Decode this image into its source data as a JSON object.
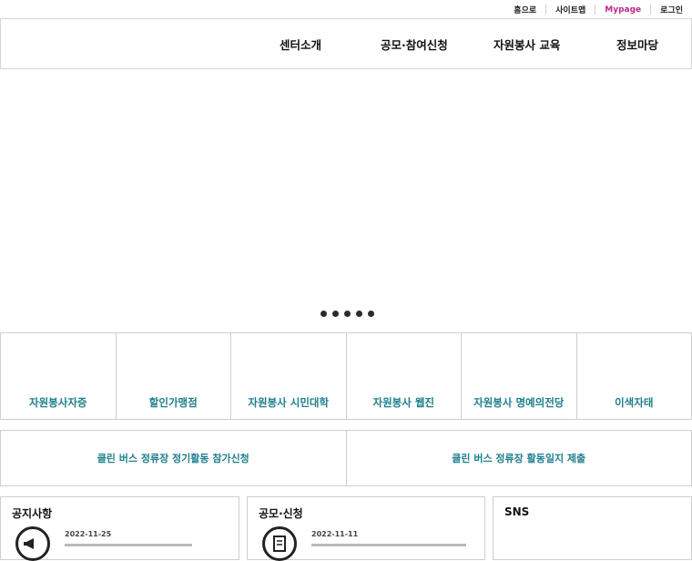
{
  "util": {
    "home": "홈으로",
    "sitemap": "사이트맵",
    "mypage": "Mypage",
    "login": "로그인"
  },
  "gnb": {
    "items": [
      "센터소개",
      "공모·참여신청",
      "자원봉사 교육",
      "정보마당"
    ]
  },
  "quick": {
    "items": [
      "자원봉사자증",
      "할인가맹점",
      "자원봉사 시민대학",
      "자원봉사 웹진",
      "자원봉사 명예의전당",
      "이색자태"
    ]
  },
  "banners": {
    "left": "클린 버스 정류장 정기활동 참가신청",
    "right": "클린 버스 정류장 활동일지 제출"
  },
  "boards": {
    "notice": {
      "title": "공지사항",
      "date": "2022-11-25",
      "icon": "megaphone-icon"
    },
    "contest": {
      "title": "공모·신청",
      "date": "2022-11-11",
      "icon": "document-icon"
    },
    "sns": {
      "title": "SNS"
    }
  },
  "colors": {
    "accent_teal": "#1f7f8c",
    "accent_magenta": "#c2248f",
    "border": "#cfcfcf"
  }
}
